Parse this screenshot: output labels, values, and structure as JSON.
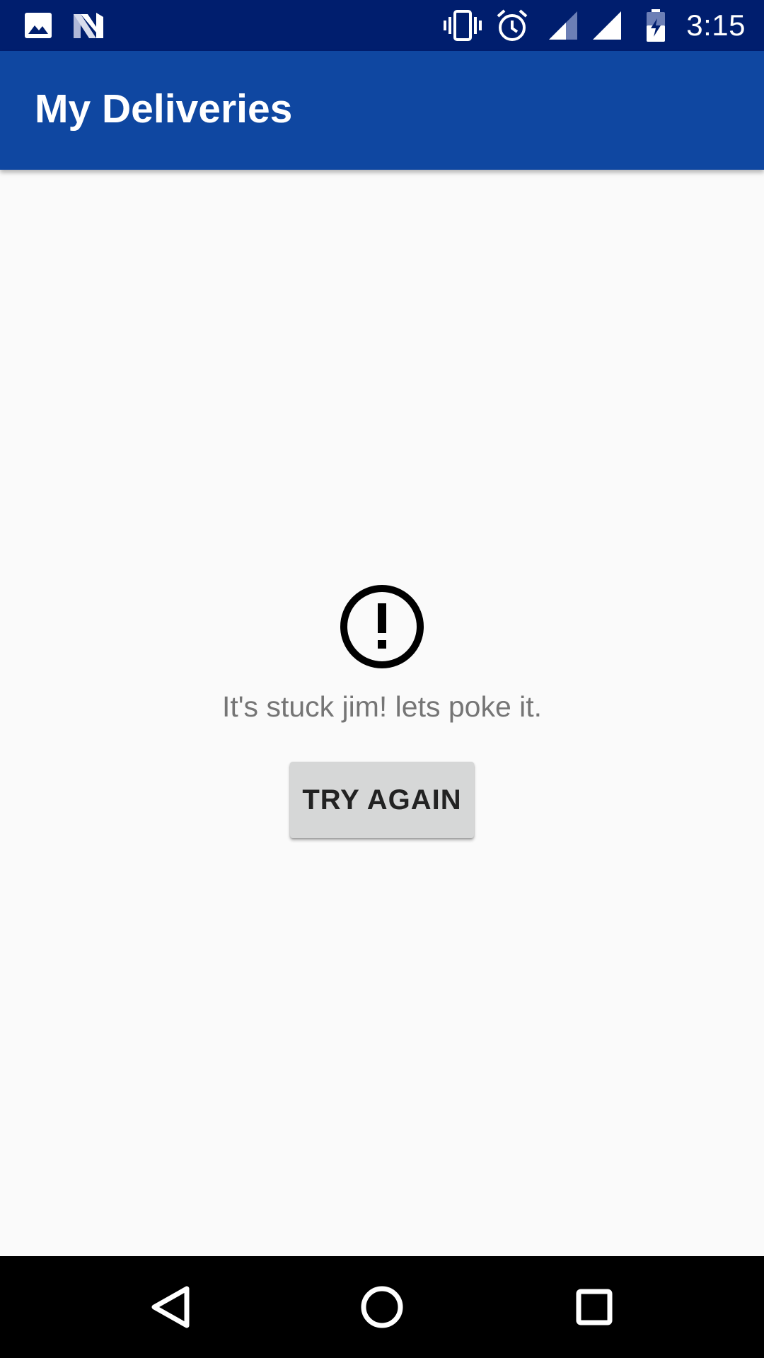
{
  "status_bar": {
    "time": "3:15",
    "icons": [
      "image-icon",
      "n-logo-icon",
      "vibrate-icon",
      "alarm-icon",
      "signal-icon",
      "signal-full-icon",
      "battery-charging-icon"
    ],
    "background": "#001e6e"
  },
  "app_bar": {
    "title": "My Deliveries",
    "background": "#0f47a1"
  },
  "error_state": {
    "icon": "error-icon",
    "message": "It's stuck jim! lets poke it.",
    "retry_label": "TRY AGAIN"
  },
  "nav_bar": {
    "icons": [
      "back-icon",
      "home-icon",
      "recents-icon"
    ]
  }
}
